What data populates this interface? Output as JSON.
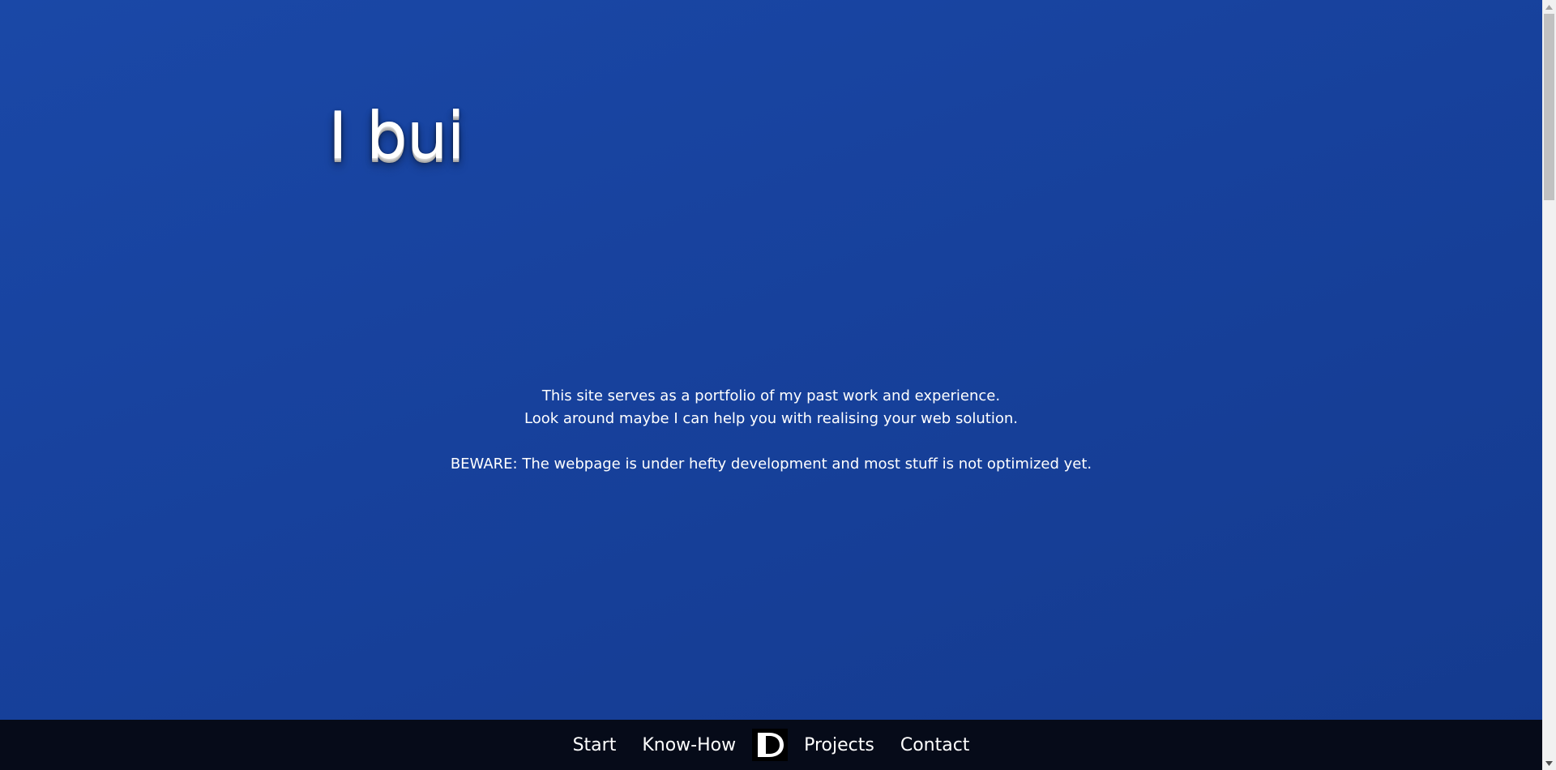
{
  "hero": {
    "title": "I bui"
  },
  "intro": {
    "line1": "This site serves as a portfolio of my past work and experience.",
    "line2": "Look around maybe I can help you with realising your web solution.",
    "warning": "BEWARE: The webpage is under hefty development and most stuff is not optimized yet."
  },
  "nav": {
    "items": [
      {
        "label": "Start"
      },
      {
        "label": "Know-How"
      },
      {
        "label": "Projects"
      },
      {
        "label": "Contact"
      }
    ],
    "logo_icon": "d-monogram-logo"
  },
  "colors": {
    "background_top": "#1a48a7",
    "background_bottom": "#143a8e",
    "footer": "#060b19",
    "text": "#ffffff"
  }
}
